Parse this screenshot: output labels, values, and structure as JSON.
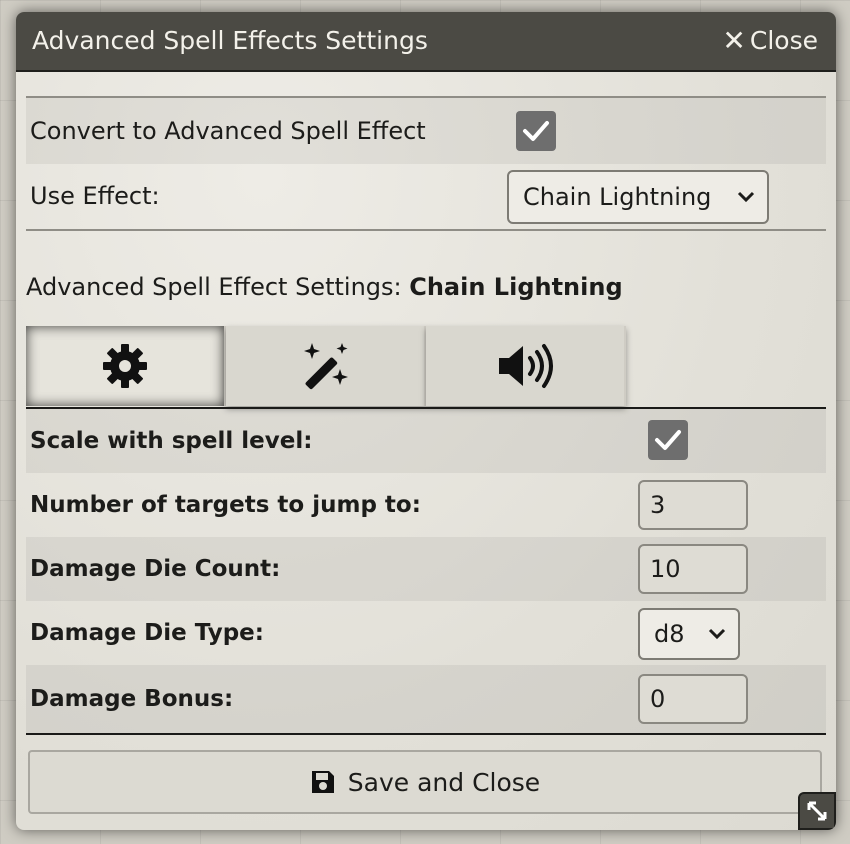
{
  "window": {
    "title": "Advanced Spell Effects Settings",
    "close_label": "Close"
  },
  "convert": {
    "label": "Convert to Advanced Spell Effect",
    "checked": true
  },
  "use_effect": {
    "label": "Use Effect:",
    "selected": "Chain Lightning"
  },
  "settings_heading": {
    "prefix": "Advanced Spell Effect Settings: ",
    "spell": "Chain Lightning"
  },
  "tabs": [
    {
      "icon": "gear-icon",
      "active": true
    },
    {
      "icon": "magic-wand-icon",
      "active": false
    },
    {
      "icon": "volume-icon",
      "active": false
    }
  ],
  "fields": {
    "scale": {
      "label": "Scale with spell level:",
      "checked": true
    },
    "targets": {
      "label": "Number of targets to jump to:",
      "value": "3"
    },
    "die_count": {
      "label": "Damage Die Count:",
      "value": "10"
    },
    "die_type": {
      "label": "Damage Die Type:",
      "selected": "d8"
    },
    "bonus": {
      "label": "Damage Bonus:",
      "value": "0"
    }
  },
  "save_button": {
    "label": "Save and Close",
    "icon": "floppy-disk-icon"
  },
  "resize_handle": {
    "icon": "resize-icon"
  }
}
